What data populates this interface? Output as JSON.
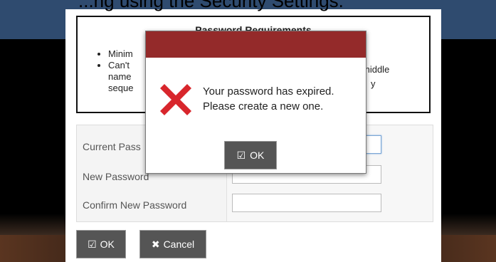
{
  "page": {
    "top_text_partial": "...ng using the Security Settings."
  },
  "requirements": {
    "title": "Password Requirements",
    "items": [
      "Minim",
      "Can't",
      "name",
      "seque"
    ],
    "right_partial": [
      "middle",
      "y"
    ]
  },
  "form": {
    "rows": [
      {
        "label": "Current Pass",
        "value": ""
      },
      {
        "label": "New Password",
        "value": ""
      },
      {
        "label": "Confirm New Password",
        "value": ""
      }
    ],
    "ok_label": "OK",
    "cancel_label": "Cancel"
  },
  "alert": {
    "message_line1": "Your password has expired.",
    "message_line2": "Please create a new one.",
    "ok_label": "OK",
    "header_color": "#942a2a",
    "icon_color": "#d8262c"
  }
}
